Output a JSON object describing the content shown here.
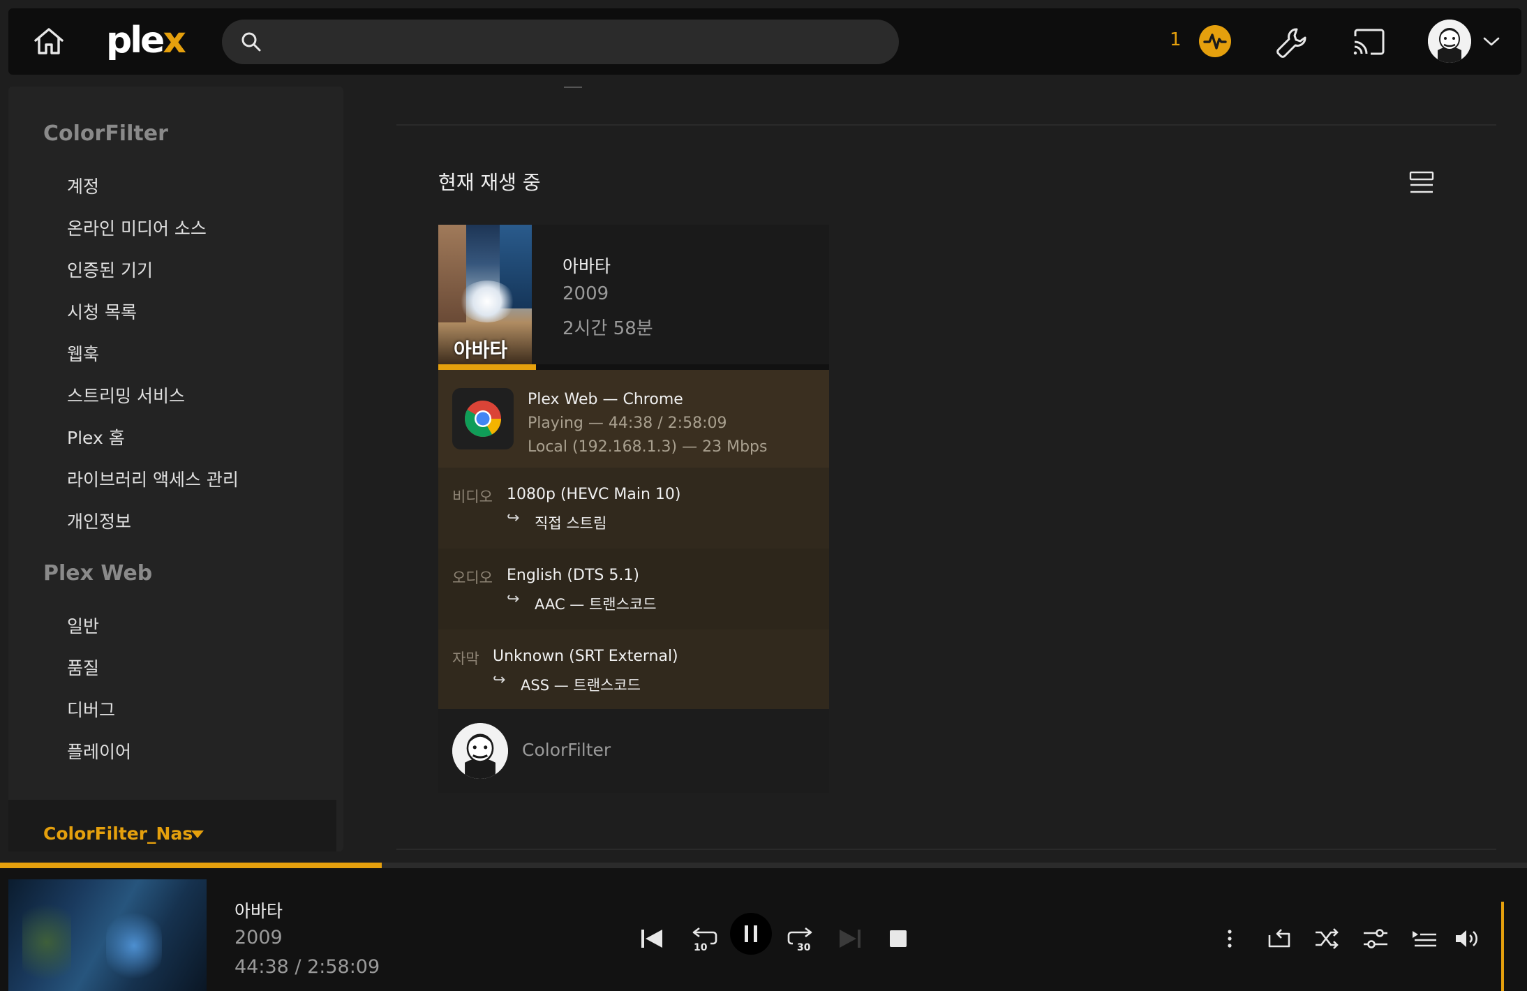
{
  "app": {
    "logo_text_a": "ple",
    "logo_text_b": "x"
  },
  "topbar": {
    "search_placeholder": "",
    "activity_count": "1",
    "colors": {
      "accent": "#e5a00d",
      "bar": "#0d0d0d"
    }
  },
  "sidebar": {
    "section_account": "ColorFilter",
    "account_items": [
      "계정",
      "온라인 미디어 소스",
      "인증된 기기",
      "시청 목록",
      "웹훅",
      "스트리밍 서비스",
      "Plex 홈",
      "라이브러리 액세스 관리",
      "개인정보"
    ],
    "section_web": "Plex Web",
    "web_items": [
      "일반",
      "품질",
      "디버그",
      "플레이어"
    ],
    "server_name": "ColorFilter_Nas"
  },
  "main": {
    "title": "현재 재생 중",
    "card": {
      "poster_title": "아바타",
      "title": "아바타",
      "year": "2009",
      "duration": "2시간 58분",
      "progress": 0.25,
      "session": {
        "line1": "Plex Web  —  Chrome",
        "line2": "Playing — 44:38 / 2:58:09",
        "line3": "Local (192.168.1.3) — 23 Mbps"
      },
      "streams": [
        {
          "label": "비디오",
          "value": "1080p (HEVC Main 10)",
          "arrow": "↪",
          "sub": "직접 스트림"
        },
        {
          "label": "오디오",
          "value": "English (DTS 5.1)",
          "arrow": "↪",
          "sub": "AAC — 트랜스코드"
        },
        {
          "label": "자막",
          "value": "Unknown (SRT External)",
          "arrow": "↪",
          "sub": "ASS — 트랜스코드"
        }
      ],
      "user": "ColorFilter"
    }
  },
  "player": {
    "title": "아바타",
    "year": "2009",
    "time": "44:38 / 2:58:09",
    "progress": 0.25,
    "rewind_label": "10",
    "forward_label": "30"
  }
}
